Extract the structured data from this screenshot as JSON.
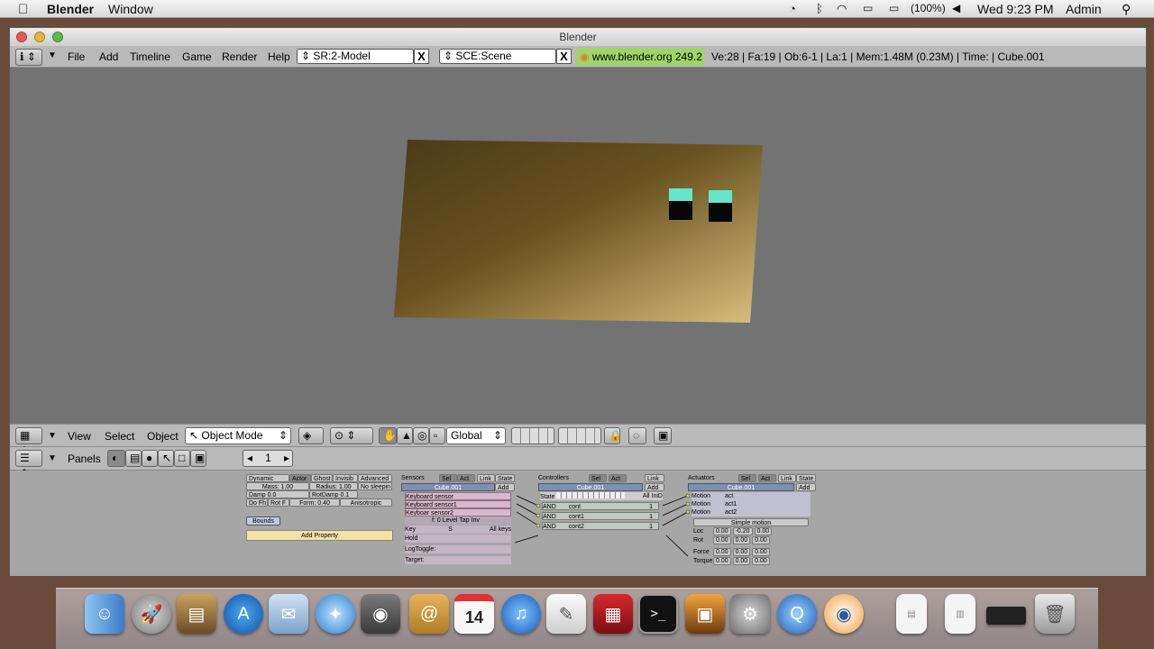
{
  "menubar": {
    "apple": "",
    "app_name": "Blender",
    "menu_window": "Window",
    "battery": "(100%)",
    "clock": "Wed 9:23 PM",
    "user": "Admin"
  },
  "window": {
    "title": "Blender"
  },
  "top_header": {
    "menus": [
      "File",
      "Add",
      "Timeline",
      "Game",
      "Render",
      "Help"
    ],
    "screen_field": "SR:2-Model",
    "scene_field": "SCE:Scene",
    "close_glyph": "X",
    "version_badge": "www.blender.org 249.2",
    "stats": "Ve:28 | Fa:19 | Ob:6-1 | La:1  | Mem:1.48M (0.23M)  | Time: | Cube.001"
  },
  "view_header": {
    "menus": [
      "View",
      "Select",
      "Object"
    ],
    "mode": "Object Mode",
    "orientation": "Global"
  },
  "buttons_header": {
    "panels": "Panels",
    "frame": "1"
  },
  "logic": {
    "physics": {
      "row1": [
        "Dynamic",
        "Actor",
        "Ghost",
        "Invisib",
        "Advanced"
      ],
      "row2": [
        "Mass: 1.00",
        "Radius: 1.00",
        "No sleepin"
      ],
      "row3": [
        "Damp 0.0",
        "RotDamp 0.1"
      ],
      "row4": [
        "Do Fh",
        "Rot F",
        "Form: 0.40",
        "Anisotropic"
      ],
      "bounds": "Bounds",
      "add_property": "Add Property"
    },
    "sensors": {
      "title": "Sensors",
      "sel": "Sel",
      "act": "Act",
      "link": "Link",
      "state": "State",
      "object": "Cube.001",
      "add": "Add",
      "items": [
        {
          "type": "Keyboard",
          "name": "sensor"
        },
        {
          "type": "Keyboard",
          "name": "sensor1"
        },
        {
          "type": "Keyboar",
          "name": "sensor2"
        }
      ],
      "f_field": "f: 0",
      "level": "Level",
      "tap": "Tap",
      "inv": "Inv",
      "key_label": "Key",
      "key_value": "S",
      "all_keys": "All keys",
      "hold": "Hold",
      "logtoggle": "LogToggle:",
      "target": "Target:"
    },
    "controllers": {
      "title": "Controllers",
      "sel": "Sel",
      "act": "Act",
      "link": "Link",
      "object": "Cube.001",
      "add": "Add",
      "state": "State",
      "all_ini": "All IniD",
      "items": [
        {
          "type": "AND",
          "name": "cont",
          "num": "1"
        },
        {
          "type": "AND",
          "name": "cont1",
          "num": "1"
        },
        {
          "type": "AND",
          "name": "cont2",
          "num": "1"
        }
      ]
    },
    "actuators": {
      "title": "Actuators",
      "sel": "Sel",
      "act": "Act",
      "link": "Link",
      "state": "State",
      "object": "Cube.001",
      "add": "Add",
      "items": [
        {
          "type": "Motion",
          "name": "act"
        },
        {
          "type": "Motion",
          "name": "act1"
        },
        {
          "type": "Motion",
          "name": "act2"
        }
      ],
      "simple_motion": "Simple motion",
      "rows": [
        {
          "label": "Loc",
          "values": [
            "0.00",
            "-0.20",
            "0.00"
          ]
        },
        {
          "label": "Rot",
          "values": [
            "0.00",
            "0.00",
            "0.00"
          ]
        },
        {
          "label": "Force",
          "values": [
            "0.00",
            "0.00",
            "0.00"
          ]
        },
        {
          "label": "Torque",
          "values": [
            "0.00",
            "0.00",
            "0.00"
          ]
        }
      ]
    }
  },
  "dock": {
    "icons": [
      "finder-icon",
      "launchpad-icon",
      "preview-icon",
      "app-store-icon",
      "mail-icon",
      "safari-icon",
      "facetime-icon",
      "contacts-icon",
      "calendar-icon",
      "itunes-icon",
      "textedit-icon",
      "photo-booth-icon",
      "terminal-icon",
      "iphoto-icon",
      "system-preferences-icon",
      "quicktime-icon",
      "blender-icon",
      "document-icon",
      "zip-icon",
      "minimized-window-icon",
      "trash-icon"
    ],
    "calendar_day": "14",
    "terminal_text": ">_"
  }
}
